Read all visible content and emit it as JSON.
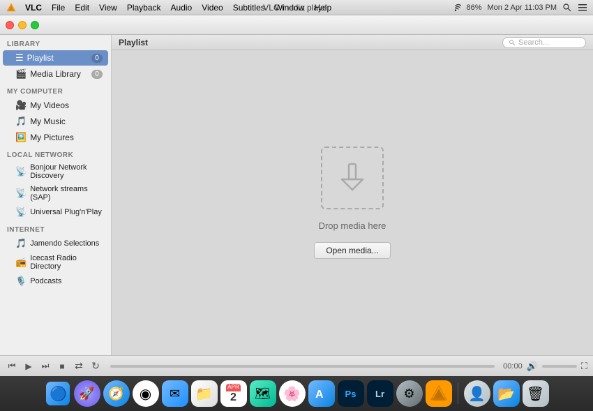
{
  "app": {
    "title": "VLC media player",
    "menubar_items": [
      "VLC",
      "File",
      "Edit",
      "View",
      "Playback",
      "Audio",
      "Video",
      "Subtitles",
      "Window",
      "Help"
    ],
    "time_right": "Mon 2 Apr  11:03 PM",
    "battery": "86%"
  },
  "sidebar": {
    "library_label": "LIBRARY",
    "my_computer_label": "MY COMPUTER",
    "local_network_label": "LOCAL NETWORK",
    "internet_label": "INTERNET",
    "items_library": [
      {
        "label": "Playlist",
        "badge": "0",
        "active": true,
        "icon": "☰"
      },
      {
        "label": "Media Library",
        "badge": "0",
        "active": false,
        "icon": "🎬"
      }
    ],
    "items_my_computer": [
      {
        "label": "My Videos",
        "icon": "🎥"
      },
      {
        "label": "My Music",
        "icon": "🎵"
      },
      {
        "label": "My Pictures",
        "icon": "🖼️"
      }
    ],
    "items_local_network": [
      {
        "label": "Bonjour Network Discovery",
        "icon": "📡"
      },
      {
        "label": "Network streams (SAP)",
        "icon": "📡"
      },
      {
        "label": "Universal Plug'n'Play",
        "icon": "📡"
      }
    ],
    "items_internet": [
      {
        "label": "Jamendo Selections",
        "icon": "🎵"
      },
      {
        "label": "Icecast Radio Directory",
        "icon": "📻"
      },
      {
        "label": "Podcasts",
        "icon": "🎙️"
      }
    ]
  },
  "content": {
    "playlist_label": "Playlist",
    "search_placeholder": "Search...",
    "drop_text": "Drop media here",
    "open_media_label": "Open media..."
  },
  "playback": {
    "time": "00:00",
    "prev_icon": "⏮",
    "play_icon": "▶",
    "next_icon": "⏭",
    "stop_icon": "■",
    "shuffle_icon": "⇄",
    "repeat_icon": "↻",
    "volume_icon": "🔊",
    "fullscreen_icon": "⛶"
  },
  "dock": {
    "items": [
      {
        "id": "finder",
        "symbol": "🔵",
        "label": "Finder"
      },
      {
        "id": "launchpad",
        "symbol": "🚀",
        "label": "Launchpad"
      },
      {
        "id": "safari",
        "symbol": "🧭",
        "label": "Safari"
      },
      {
        "id": "chrome",
        "symbol": "◎",
        "label": "Chrome"
      },
      {
        "id": "mail",
        "symbol": "✉",
        "label": "Mail"
      },
      {
        "id": "files",
        "symbol": "📁",
        "label": "Files"
      },
      {
        "id": "calendar",
        "symbol": "📅",
        "label": "Calendar"
      },
      {
        "id": "maps",
        "symbol": "🗺",
        "label": "Maps"
      },
      {
        "id": "photos",
        "symbol": "🌸",
        "label": "Photos"
      },
      {
        "id": "appstore",
        "symbol": "A",
        "label": "App Store"
      },
      {
        "id": "ps",
        "symbol": "Ps",
        "label": "Photoshop"
      },
      {
        "id": "lr",
        "symbol": "Lr",
        "label": "Lightroom"
      },
      {
        "id": "settings",
        "symbol": "⚙",
        "label": "System Preferences"
      },
      {
        "id": "vlc",
        "symbol": "🔶",
        "label": "VLC"
      },
      {
        "id": "portrait",
        "symbol": "👤",
        "label": "Portrait"
      },
      {
        "id": "finder2",
        "symbol": "📂",
        "label": "Finder"
      },
      {
        "id": "trash",
        "symbol": "🗑",
        "label": "Trash"
      }
    ]
  }
}
